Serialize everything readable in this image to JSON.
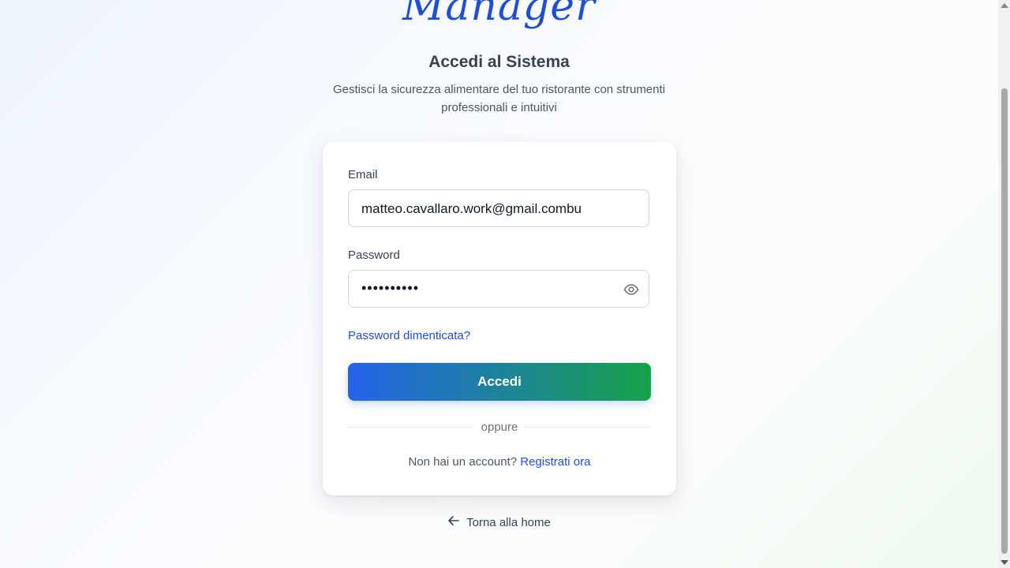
{
  "brand": {
    "text": "Manager"
  },
  "header": {
    "title": "Accedi al Sistema",
    "subtitle": "Gestisci la sicurezza alimentare del tuo ristorante con strumenti professionali e intuitivi"
  },
  "form": {
    "email_label": "Email",
    "email_value": "matteo.cavallaro.work@gmail.combu",
    "password_label": "Password",
    "password_masked": "••••••••••",
    "password_toggle_icon": "eye-icon",
    "forgot_link": "Password dimenticata?",
    "submit_label": "Accedi",
    "divider_text": "oppure",
    "signup_prompt": "Non hai un account?",
    "signup_link": "Registrati ora"
  },
  "footer": {
    "back_label": "Torna alla home",
    "back_icon": "arrow-left-icon"
  },
  "colors": {
    "accent": "#1d4ed8",
    "gradient_start": "#2563eb",
    "gradient_end": "#16a34a"
  }
}
